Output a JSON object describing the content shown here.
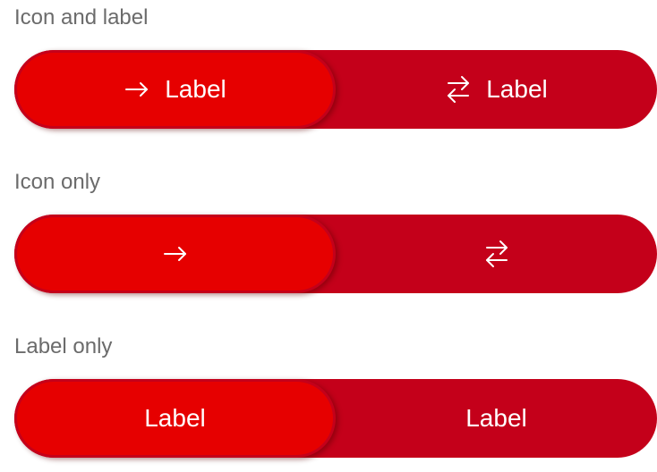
{
  "sections": [
    {
      "heading": "Icon and label",
      "segments": [
        {
          "label": "Label",
          "icon": "arrow-right-icon",
          "selected": true
        },
        {
          "label": "Label",
          "icon": "swap-arrows-icon",
          "selected": false
        }
      ]
    },
    {
      "heading": "Icon only",
      "segments": [
        {
          "icon": "arrow-right-icon",
          "selected": true
        },
        {
          "icon": "swap-arrows-icon",
          "selected": false
        }
      ]
    },
    {
      "heading": "Label only",
      "segments": [
        {
          "label": "Label",
          "selected": true
        },
        {
          "label": "Label",
          "selected": false
        }
      ]
    }
  ],
  "colors": {
    "track": "#c4001a",
    "selected": "#e60000",
    "text": "#ffffff",
    "heading": "#6b6b6b"
  }
}
